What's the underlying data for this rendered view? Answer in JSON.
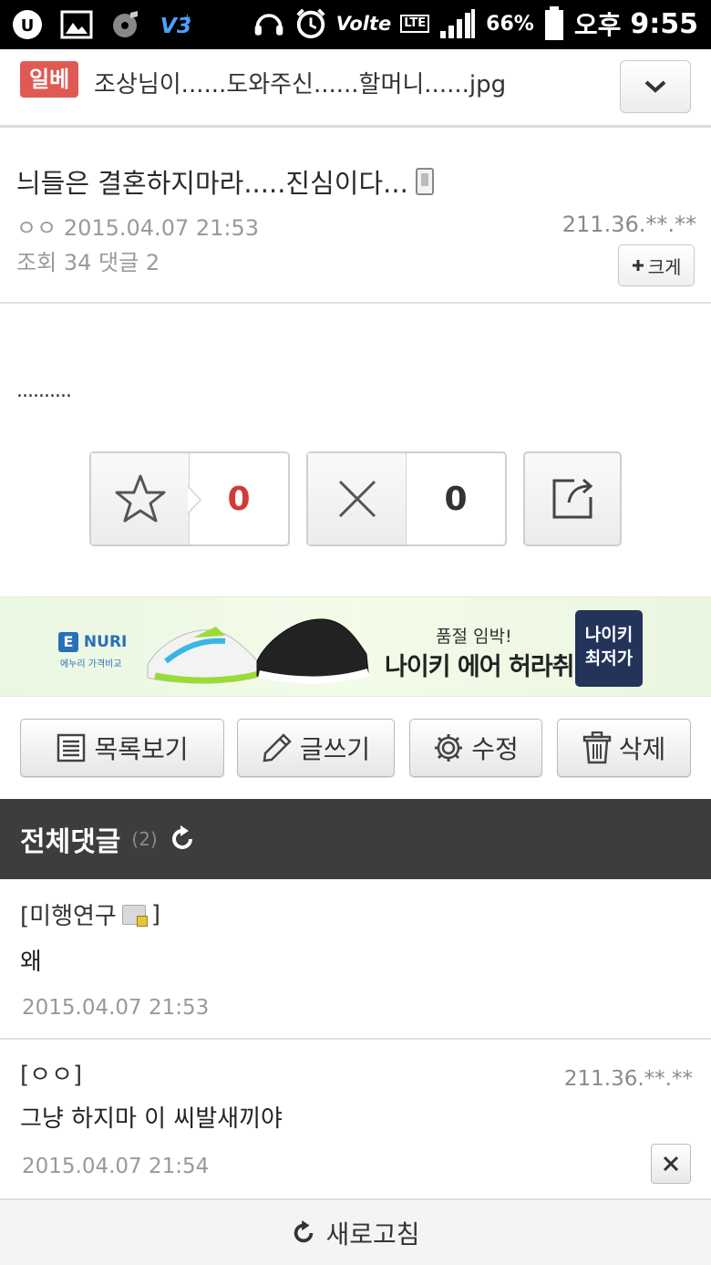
{
  "status_bar": {
    "lte_label": "LTE",
    "volte_label": "Volte",
    "battery": "66%",
    "ampm": "오후",
    "time": "9:55"
  },
  "board": {
    "badge": "일베",
    "title": "조상님이......도와주신......할머니......jpg"
  },
  "post": {
    "title": "늬들은 결혼하지마라.....진심이다...",
    "author": "ㅇㅇ",
    "datetime": "2015.04.07 21:53",
    "ip": "211.36.**.**",
    "views_label": "조회",
    "views": "34",
    "comments_label": "댓글",
    "comments": "2",
    "enlarge_label": "크게",
    "body": "..........",
    "recommend_count": "0",
    "reject_count": "0"
  },
  "ad": {
    "brand": "NURI",
    "brand_sub": "에누리 가격비교",
    "small_text": "품절 임박!",
    "big_text": "나이키 에어 허라취",
    "cta_line1": "나이키",
    "cta_line2": "최저가"
  },
  "actions": {
    "list": "목록보기",
    "write": "글쓰기",
    "edit": "수정",
    "delete": "삭제"
  },
  "comments_section": {
    "title": "전체댓글",
    "count": "(2)",
    "items": [
      {
        "author": "[미행연구",
        "author_close": "]",
        "text": "왜",
        "date": "2015.04.07 21:53"
      },
      {
        "author": "[ㅇㅇ]",
        "ip": "211.36.**.**",
        "text": "그냥 하지마 이 씨발새끼야",
        "date": "2015.04.07 21:54"
      }
    ]
  },
  "refresh_label": "새로고침",
  "colors": {
    "badge": "#e05a55",
    "recommend": "#d13a36",
    "comments_header": "#3d3d3d",
    "ad_cta": "#23335a"
  }
}
